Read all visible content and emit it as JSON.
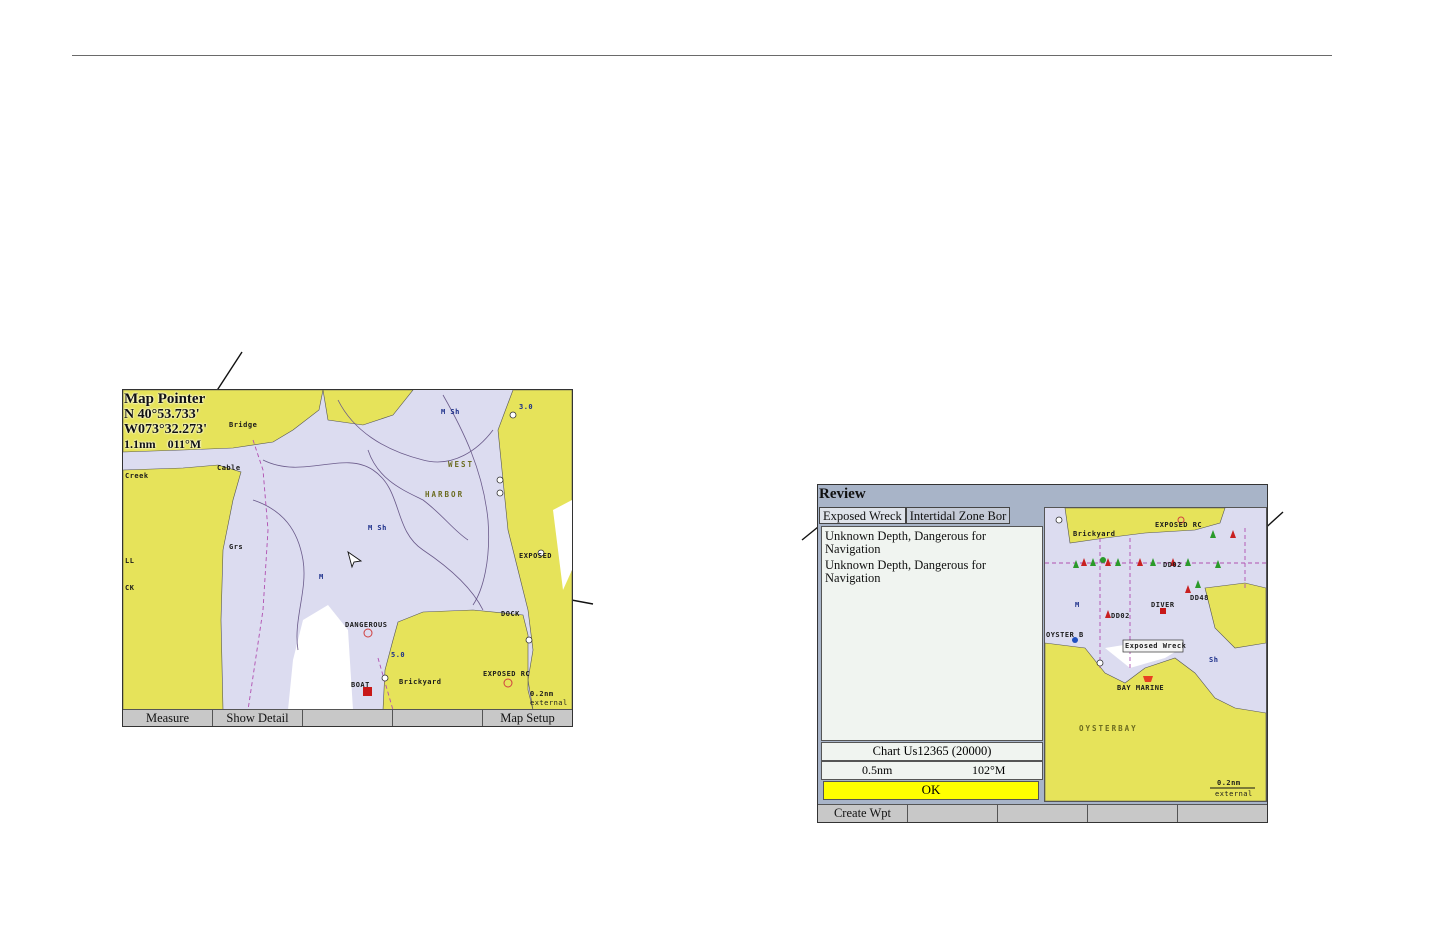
{
  "map_pointer_screen": {
    "title": "Map Pointer",
    "latitude": "N  40°53.733'",
    "longitude": "W073°32.273'",
    "distance": "1.1nm",
    "bearing": "011°M",
    "labels": {
      "bridge": "Bridge",
      "cable": "Cable",
      "creek": "Creek",
      "grs": "Grs",
      "ll": "LL",
      "ck": "CK",
      "msh1": "M Sh",
      "msh2": "M Sh",
      "m": "M",
      "west": "WEST",
      "harbor": "HARBOR",
      "depth_3": "3.0",
      "depth_5": "5.0",
      "exposed": "EXPOSED",
      "dock": "DOCK",
      "dangerous": "DANGEROUS",
      "exposed_rc": "EXPOSED RC",
      "brickyard": "Brickyard",
      "boat": "BOAT",
      "scale": "0.2nm",
      "scale_mode": "external"
    },
    "softkeys": [
      "Measure",
      "Show Detail",
      "",
      "",
      "Map Setup"
    ]
  },
  "review_screen": {
    "title": "Review",
    "tabs": [
      "Exposed Wreck",
      "Intertidal Zone Bor"
    ],
    "description": [
      "Unknown Depth, Dangerous for Navigation",
      "Unknown Depth, Dangerous for Navigation"
    ],
    "chart": "Chart Us12365 (20000)",
    "distance": "0.5nm",
    "bearing": "102°M",
    "ok_label": "OK",
    "map_labels": {
      "exposed_rc": "EXPOSED RC",
      "brickyard": "Brickyard",
      "dd02_a": "DD02",
      "dd02_b": "DD02",
      "dd48": "DD48",
      "diver": "DIVER",
      "oyster": "OYSTER B",
      "exposed_wreck": "Exposed Wreck",
      "bay_marine": "BAY MARINE",
      "oysterbay": "OYSTERBAY",
      "m": "M",
      "sh": "Sh",
      "scale": "0.2nm",
      "scale_mode": "external"
    },
    "softkeys": [
      "Create Wpt",
      "",
      "",
      "",
      ""
    ]
  },
  "colors": {
    "land": "#e6e35a",
    "water_shallow": "#dcdcf0",
    "water_deep": "#ffffff",
    "ok_button": "#ffff00"
  }
}
